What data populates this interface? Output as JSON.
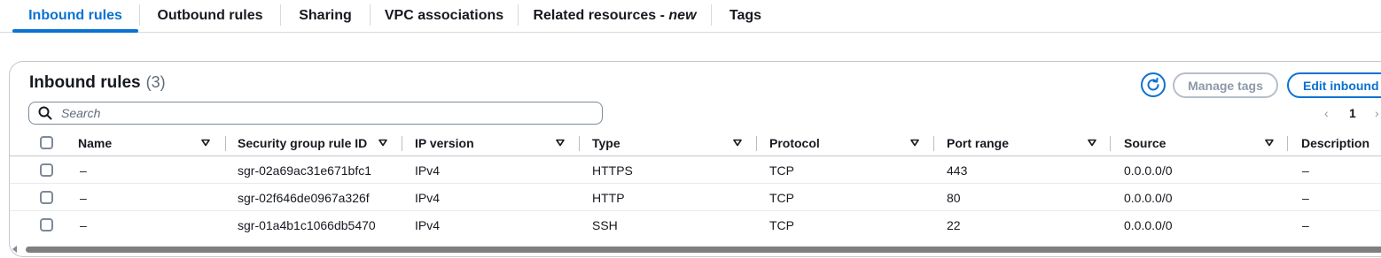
{
  "tabs": [
    {
      "label": "Inbound rules",
      "active": true
    },
    {
      "label": "Outbound rules",
      "active": false
    },
    {
      "label": "Sharing",
      "active": false
    },
    {
      "label": "VPC associations",
      "active": false
    },
    {
      "label": "Related resources - ",
      "suffix": "new",
      "active": false
    },
    {
      "label": "Tags",
      "active": false
    }
  ],
  "panel": {
    "title": "Inbound rules",
    "count": "(3)",
    "refresh_icon": "refresh-icon",
    "manage_tags_label": "Manage tags",
    "edit_inbound_label": "Edit inbound"
  },
  "search": {
    "placeholder": "Search",
    "icon": "search-icon"
  },
  "pagination": {
    "prev": "‹",
    "current": "1",
    "next": "›"
  },
  "table": {
    "columns": [
      {
        "label": "Name"
      },
      {
        "label": "Security group rule ID"
      },
      {
        "label": "IP version"
      },
      {
        "label": "Type"
      },
      {
        "label": "Protocol"
      },
      {
        "label": "Port range"
      },
      {
        "label": "Source"
      },
      {
        "label": "Description"
      }
    ],
    "rows": [
      {
        "name": "–",
        "rule_id": "sgr-02a69ac31e671bfc1",
        "ip_version": "IPv4",
        "type": "HTTPS",
        "protocol": "TCP",
        "port_range": "443",
        "source": "0.0.0.0/0",
        "description": "–"
      },
      {
        "name": "–",
        "rule_id": "sgr-02f646de0967a326f",
        "ip_version": "IPv4",
        "type": "HTTP",
        "protocol": "TCP",
        "port_range": "80",
        "source": "0.0.0.0/0",
        "description": "–"
      },
      {
        "name": "–",
        "rule_id": "sgr-01a4b1c1066db5470",
        "ip_version": "IPv4",
        "type": "SSH",
        "protocol": "TCP",
        "port_range": "22",
        "source": "0.0.0.0/0",
        "description": "–"
      }
    ]
  },
  "colors": {
    "accent": "#0972d3",
    "text": "#16191f",
    "muted": "#5f6b7a",
    "disabled": "#8d99a8"
  }
}
